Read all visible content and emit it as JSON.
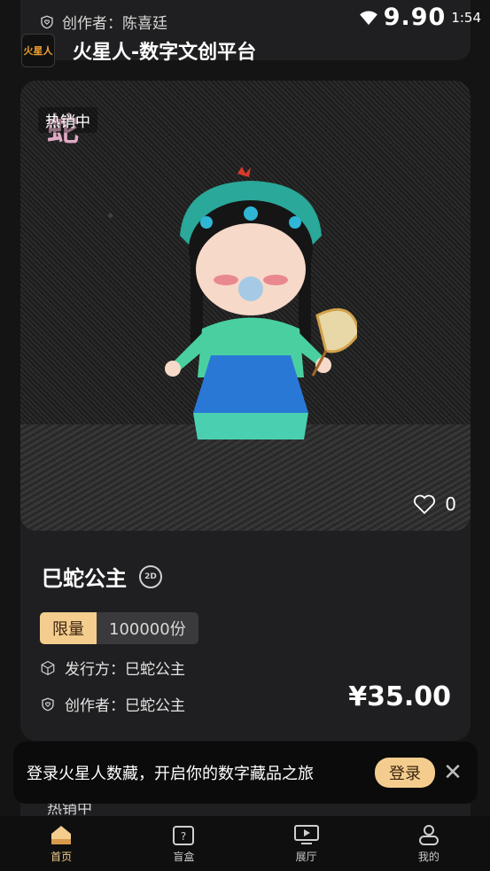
{
  "top": {
    "prev_creator_label": "创作者：陈喜廷",
    "status_overlay": "9.90",
    "status_time": "1:54",
    "logo_text": "火星人",
    "app_title": "火星人-数字文创平台"
  },
  "card": {
    "image_caption": "蛇",
    "hot_badge": "热销中",
    "likes": "0",
    "title": "巳蛇公主",
    "badge_2d": "2D",
    "limit_label": "限量",
    "limit_count": "100000份",
    "issuer": "发行方：巳蛇公主",
    "creator": "创作者：巳蛇公主",
    "price": "¥35.00"
  },
  "next_card": {
    "hot_badge": "热销中"
  },
  "login_toast": {
    "text": "登录火星人数藏，开启你的数字藏品之旅",
    "button": "登录"
  },
  "tabs": [
    {
      "label": "首页",
      "icon": "home-icon",
      "active": true
    },
    {
      "label": "盲盒",
      "icon": "blind-box-icon",
      "active": false
    },
    {
      "label": "展厅",
      "icon": "exhibition-icon",
      "active": false
    },
    {
      "label": "我的",
      "icon": "profile-icon",
      "active": false
    }
  ],
  "colors": {
    "accent": "#f4cd8e",
    "card_bg": "#1f1f21",
    "page_bg": "#141414"
  }
}
